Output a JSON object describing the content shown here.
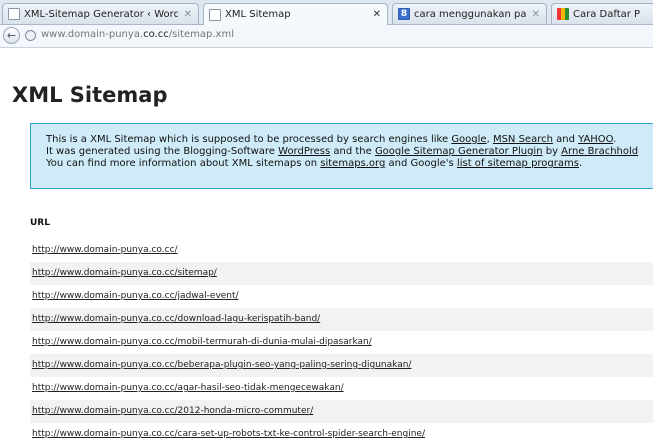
{
  "tabs": [
    {
      "title": "XML-Sitemap Generator ‹ Word...",
      "favicon": "page-icon",
      "active": false
    },
    {
      "title": "XML Sitemap",
      "favicon": "page-icon",
      "active": true
    },
    {
      "title": "cara menggunakan paket fufko...",
      "favicon": "google-icon",
      "active": false
    },
    {
      "title": "Cara Daftar P",
      "favicon": "colorful-icon",
      "active": false
    }
  ],
  "address": {
    "prefix": "www.domain-punya.",
    "host": "co.cc",
    "path": "/sitemap.xml"
  },
  "page": {
    "title": "XML Sitemap",
    "intro": {
      "l1_a": "This is a XML Sitemap which is supposed to be processed by search engines like ",
      "l1_google": "Google",
      "l1_b": ", ",
      "l1_msn": "MSN Search",
      "l1_c": " and ",
      "l1_yahoo": "YAHOO",
      "l1_d": ".",
      "l2_a": "It was generated using the Blogging-Software ",
      "l2_wp": "WordPress",
      "l2_b": " and the ",
      "l2_plugin": "Google Sitemap Generator Plugin",
      "l2_c": " by ",
      "l2_author": "Arne Brachhold",
      "l3_a": "You can find more information about XML sitemaps on ",
      "l3_sitemaps": "sitemaps.org",
      "l3_b": " and Google's ",
      "l3_list": "list of sitemap programs",
      "l3_c": "."
    },
    "column_header": "URL",
    "urls": [
      "http://www.domain-punya.co.cc/",
      "http://www.domain-punya.co.cc/sitemap/",
      "http://www.domain-punya.co.cc/jadwal-event/",
      "http://www.domain-punya.co.cc/download-lagu-kerispatih-band/",
      "http://www.domain-punya.co.cc/mobil-termurah-di-dunia-mulai-dipasarkan/",
      "http://www.domain-punya.co.cc/beberapa-plugin-seo-yang-paling-sering-digunakan/",
      "http://www.domain-punya.co.cc/agar-hasil-seo-tidak-mengecewakan/",
      "http://www.domain-punya.co.cc/2012-honda-micro-commuter/",
      "http://www.domain-punya.co.cc/cara-set-up-robots-txt-ke-control-spider-search-engine/"
    ]
  }
}
